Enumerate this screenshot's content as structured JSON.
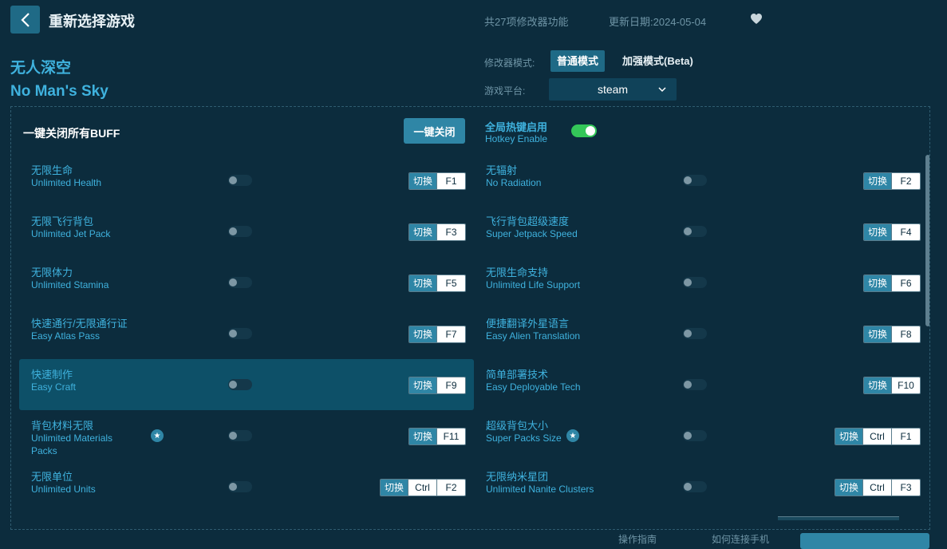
{
  "header": {
    "back_icon": "chevron-left-icon",
    "title": "重新选择游戏",
    "feature_count": "共27项修改器功能",
    "update_date": "更新日期:2024-05-04",
    "favorite_icon": "heart-icon"
  },
  "game": {
    "name_cn": "无人深空",
    "name_en": "No Man's Sky"
  },
  "mode": {
    "label": "修改器模式:",
    "normal": "普通模式",
    "beta": "加强模式(Beta)",
    "selected": "普通模式"
  },
  "platform": {
    "label": "游戏平台:",
    "value": "steam"
  },
  "panel": {
    "all_off_label": "一键关闭所有BUFF",
    "all_off_button": "一键关闭",
    "hotkey_cn": "全局热键启用",
    "hotkey_en": "Hotkey Enable",
    "hotkey_enabled": true
  },
  "switch_label": "切换",
  "cheats": [
    {
      "cn": "无限生命",
      "en": "Unlimited Health",
      "keys": [
        "F1"
      ],
      "enabled": false
    },
    {
      "cn": "无辐射",
      "en": "No Radiation",
      "keys": [
        "F2"
      ],
      "enabled": false
    },
    {
      "cn": "无限飞行背包",
      "en": "Unlimited Jet Pack",
      "keys": [
        "F3"
      ],
      "enabled": false
    },
    {
      "cn": "飞行背包超级速度",
      "en": "Super Jetpack Speed",
      "keys": [
        "F4"
      ],
      "enabled": false
    },
    {
      "cn": "无限体力",
      "en": "Unlimited Stamina",
      "keys": [
        "F5"
      ],
      "enabled": false
    },
    {
      "cn": "无限生命支持",
      "en": "Unlimited Life Support",
      "keys": [
        "F6"
      ],
      "enabled": false
    },
    {
      "cn": "快速通行/无限通行证",
      "en": "Easy Atlas Pass",
      "keys": [
        "F7"
      ],
      "enabled": false
    },
    {
      "cn": "便捷翻译外星语言",
      "en": "Easy Alien Translation",
      "keys": [
        "F8"
      ],
      "enabled": false
    },
    {
      "cn": "快速制作",
      "en": "Easy Craft",
      "keys": [
        "F9"
      ],
      "enabled": false,
      "highlighted": true
    },
    {
      "cn": "简单部署技术",
      "en": "Easy Deployable Tech",
      "keys": [
        "F10"
      ],
      "enabled": false
    },
    {
      "cn": "背包材料无限",
      "en": "Unlimited Materials Packs",
      "keys": [
        "F11"
      ],
      "enabled": false,
      "star": true
    },
    {
      "cn": "超级背包大小",
      "en": "Super Packs Size",
      "keys": [
        "Ctrl",
        "F1"
      ],
      "enabled": false,
      "star": true
    },
    {
      "cn": "无限单位",
      "en": "Unlimited Units",
      "keys": [
        "Ctrl",
        "F2"
      ],
      "enabled": false
    },
    {
      "cn": "无限纳米星团",
      "en": "Unlimited Nanite Clusters",
      "keys": [
        "Ctrl",
        "F3"
      ],
      "enabled": false
    }
  ],
  "footer": {
    "guide": "操作指南",
    "phone": "如何连接手机"
  },
  "colors": {
    "background": "#0c2c3d",
    "accent": "#3fb2de",
    "button": "#2f86a6",
    "toggle_on": "#34c759"
  }
}
